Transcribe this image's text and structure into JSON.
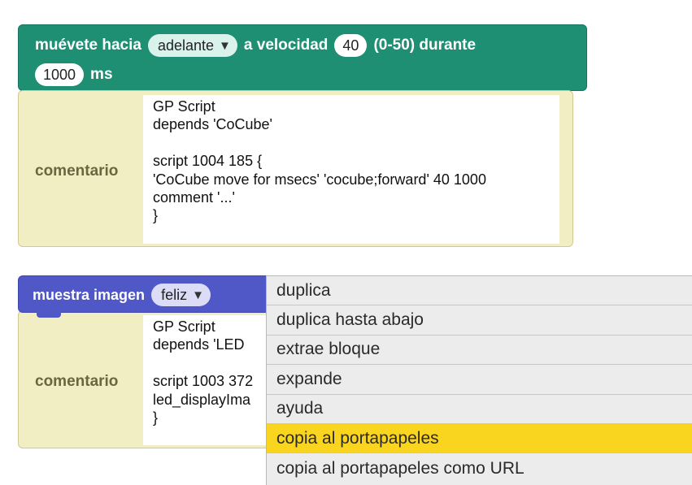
{
  "move_block": {
    "label_move": "muévete hacia",
    "direction_value": "adelante",
    "label_speed": "a velocidad",
    "speed_value": "40",
    "label_range": "(0-50) durante",
    "duration_value": "1000",
    "label_unit": "ms",
    "color": "#1e8f73"
  },
  "comment1": {
    "label": "comentario",
    "text": "GP Script\ndepends 'CoCube'\n\nscript 1004 185 {\n'CoCube move for msecs' 'cocube;forward' 40 1000\ncomment '...'\n}"
  },
  "image_block": {
    "label": "muestra imagen",
    "image_value": "feliz",
    "color": "#5057c7"
  },
  "comment2": {
    "label": "comentario",
    "text": "GP Script\ndepends 'LED\n\nscript 1003 372\nled_displayIma\n}"
  },
  "context_menu": {
    "items": [
      {
        "label": "duplica"
      },
      {
        "label": "duplica hasta abajo"
      },
      {
        "label": "extrae bloque"
      },
      {
        "label": "expande"
      },
      {
        "label": "ayuda"
      },
      {
        "label": "copia al portapapeles",
        "highlighted": true
      },
      {
        "label": "copia al portapapeles como URL"
      }
    ],
    "highlight_color": "#fad51f"
  }
}
